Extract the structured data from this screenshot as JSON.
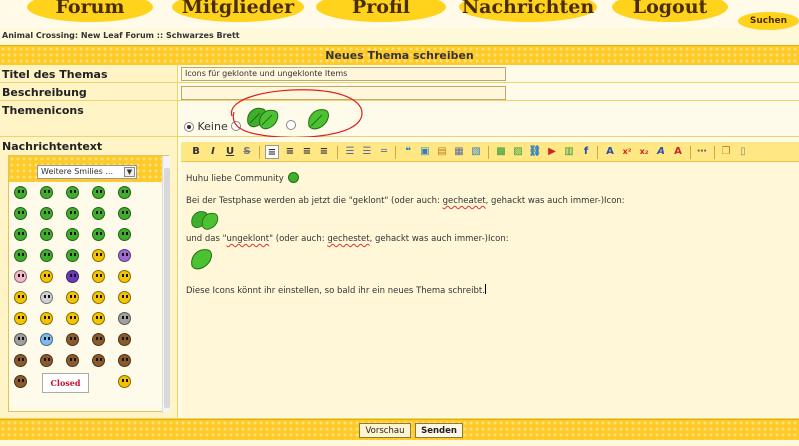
{
  "nav": {
    "items": [
      "Forum",
      "Mitglieder",
      "Profil",
      "Nachrichten",
      "Logout"
    ],
    "search_label": "Suchen"
  },
  "breadcrumb": "Animal Crossing: New Leaf Forum :: Schwarzes Brett",
  "form": {
    "header": "Neues Thema schreiben",
    "topic_title_label": "Titel des Themas",
    "topic_title_value": "Icons für geklonte und ungeklonte Items",
    "description_label": "Beschreibung",
    "description_value": "",
    "topic_icons_label": "Themenicons",
    "icon_none_label": "Keine",
    "message_label": "Nachrichtentext"
  },
  "smilies": {
    "select_value": "Weitere Smilies ...",
    "closed_sign": "Closed"
  },
  "toolbar": {
    "bold": "B",
    "italic": "I",
    "underline": "U",
    "strike": "S"
  },
  "editor": {
    "line1": "Huhu liebe Community",
    "line2_pre": "Bei der Testphase werden ab jetzt die \"geklont\" (oder auch: ",
    "line2_sq": "gecheatet",
    "line2_post": ", gehackt was auch immer-)Icon:",
    "line3_pre": "und das \"",
    "line3_sq1": "ungeklont",
    "line3_mid": "\" (oder auch: ",
    "line3_sq2": "gechestet",
    "line3_post": ", gehackt was auch immer-)Icon:",
    "line4": "Diese Icons könnt ihr einstellen, so bald ihr ein neues Thema schreibt."
  },
  "buttons": {
    "preview": "Vorschau",
    "send": "Senden"
  },
  "colors": {
    "accent": "#ffc928",
    "nav_text": "#4a2c00",
    "annotation": "#e02020",
    "leaf": "#3fae2a"
  }
}
